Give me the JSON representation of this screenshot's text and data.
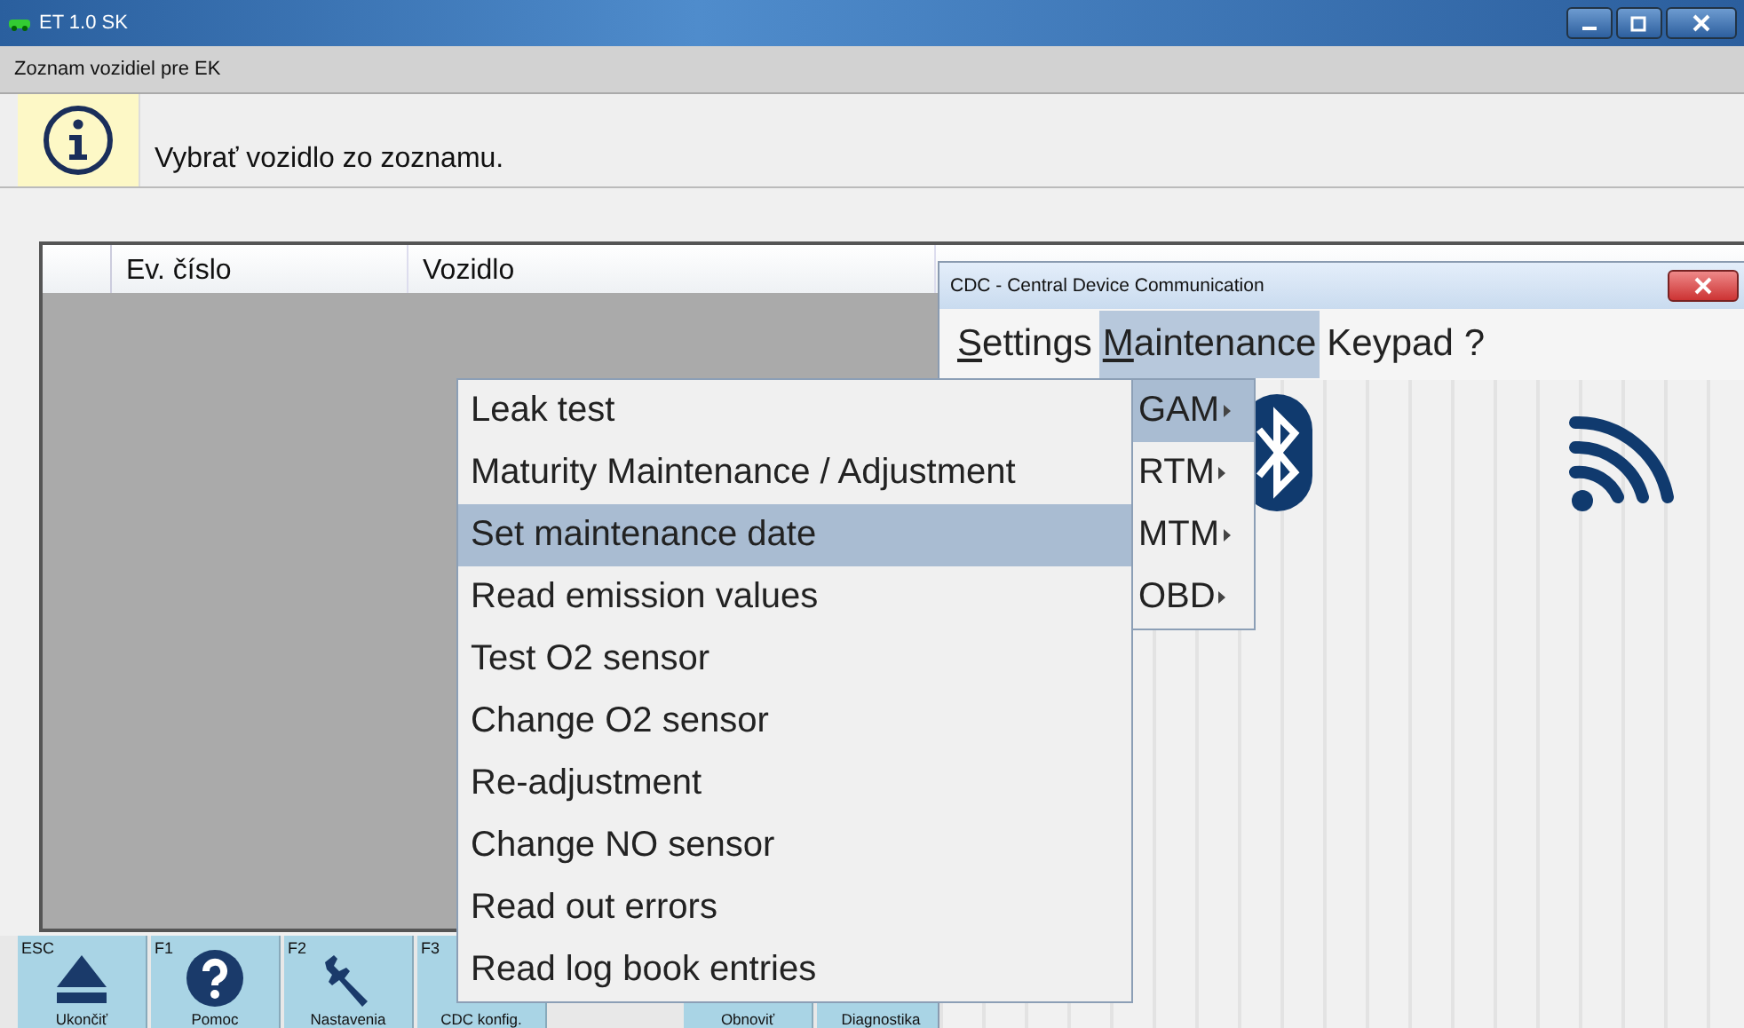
{
  "main_window": {
    "title": "ET 1.0 SK",
    "subtitle": "Zoznam vozidiel pre EK",
    "info_message": "Vybrať vozidlo zo zoznamu.",
    "table": {
      "columns": [
        "Ev. číslo",
        "Vozidlo"
      ]
    },
    "toolbar": [
      {
        "key": "ESC",
        "label": "Ukončiť"
      },
      {
        "key": "F1",
        "label": "Pomoc"
      },
      {
        "key": "F2",
        "label": "Nastavenia"
      },
      {
        "key": "F3",
        "label": "CDC konfig."
      },
      {
        "label": "Obnoviť"
      },
      {
        "label": "Diagnostika"
      }
    ]
  },
  "cdc_window": {
    "title": "CDC - Central Device Communication",
    "menu": [
      {
        "label": "Settings",
        "underline_first": true,
        "selected": false
      },
      {
        "label": "Maintenance",
        "underline_first": true,
        "selected": true
      },
      {
        "label": "Keypad",
        "underline_first": false,
        "selected": false
      },
      {
        "label": "?",
        "underline_first": false,
        "selected": false
      }
    ]
  },
  "maintenance_menu": [
    {
      "label": "GAM",
      "has_submenu": true,
      "selected": true
    },
    {
      "label": "RTM",
      "has_submenu": true,
      "selected": false
    },
    {
      "label": "MTM",
      "has_submenu": true,
      "selected": false
    },
    {
      "label": "OBD",
      "has_submenu": true,
      "selected": false
    }
  ],
  "gam_submenu": [
    {
      "label": "Leak test",
      "selected": false
    },
    {
      "label": "Maturity Maintenance / Adjustment",
      "selected": false
    },
    {
      "label": "Set maintenance date",
      "selected": true
    },
    {
      "label": "Read emission values",
      "selected": false
    },
    {
      "label": "Test O2 sensor",
      "selected": false
    },
    {
      "label": "Change O2 sensor",
      "selected": false
    },
    {
      "label": "Re-adjustment",
      "selected": false
    },
    {
      "label": "Change NO sensor",
      "selected": false
    },
    {
      "label": "Read out errors",
      "selected": false
    },
    {
      "label": "Read log book entries",
      "selected": false
    }
  ]
}
